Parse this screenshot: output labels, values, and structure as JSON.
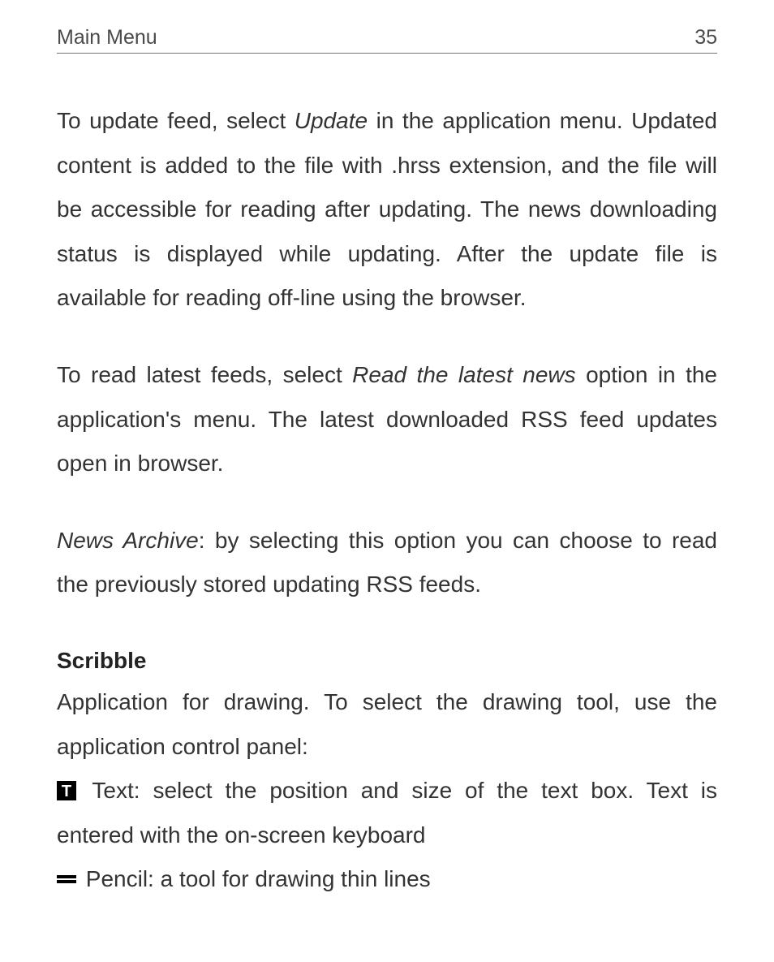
{
  "header": {
    "title": "Main Menu",
    "page_number": "35"
  },
  "paragraphs": {
    "p1_a": "To update feed, select ",
    "p1_em1": "Update",
    "p1_b": " in the application menu. Updated content is added to the file with .hrss extension, and the file will be accessible for reading after updating. The news downloading status is displayed while updating. After the update file is available for reading off-line using the browser.",
    "p2_a": "To read latest feeds, select ",
    "p2_em1": "Read the latest news",
    "p2_b": " option in the application's menu. The latest downloaded RSS feed updates open in browser.",
    "p3_em1": "News Archive",
    "p3_b": ": by selecting this option you can choose to read the previously stored updating RSS feeds."
  },
  "section": {
    "title": "Scribble",
    "intro": "Application for drawing. To select the drawing tool, use the application control panel:",
    "tool_text": " Text: select the position and size of the text box. Text is entered with the on-screen keyboard",
    "tool_pencil": " Pencil: a tool for drawing thin lines"
  }
}
